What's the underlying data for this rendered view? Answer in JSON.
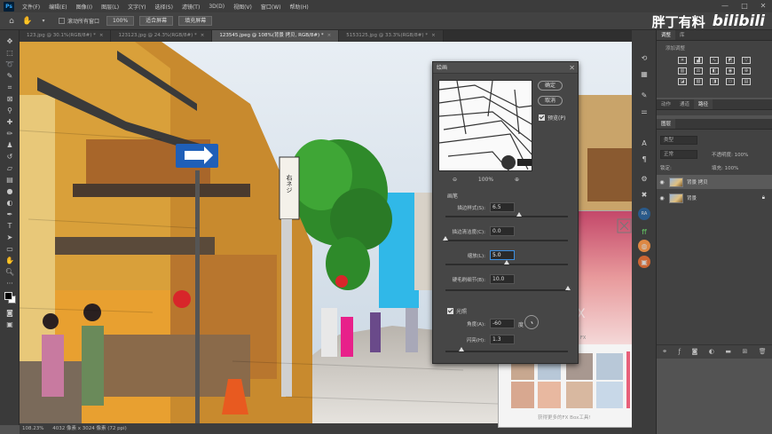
{
  "menubar": {
    "items": [
      "文件(F)",
      "编辑(E)",
      "图像(I)",
      "图层(L)",
      "文字(Y)",
      "选择(S)",
      "滤镜(T)",
      "3D(D)",
      "视图(V)",
      "窗口(W)",
      "帮助(H)"
    ],
    "window_controls": [
      "—",
      "□",
      "✕"
    ]
  },
  "options_bar": {
    "scroll_all_label": "滚动所有窗口",
    "zoom_value": "100%",
    "fit_screen": "适合屏幕",
    "fill_screen": "填充屏幕"
  },
  "brand": {
    "text": "胖丁有料",
    "logo": "bilibili"
  },
  "tabs": [
    {
      "label": "123.jpg @ 30.1%(RGB/8#) *",
      "active": false
    },
    {
      "label": "123123.jpg @ 24.3%(RGB/8#) *",
      "active": false
    },
    {
      "label": "123545.jpeg @ 108%(背景 拷贝, RGB/8#) *",
      "active": true
    },
    {
      "label": "5153125.jpg @ 33.3%(RGB/8#) *",
      "active": false
    }
  ],
  "status_bar": {
    "zoom": "108.23%",
    "doc_info": "4032 像素 x 3024 像素 (72 ppi)"
  },
  "dialog": {
    "title": "绘画",
    "ok": "确定",
    "cancel": "取消",
    "preview_label": "预览(P)",
    "zoom_percent": "100%",
    "section_brush": "画笔",
    "params": [
      {
        "label": "描边样式(S):",
        "value": "6.5",
        "slider_fraction": 0.6
      },
      {
        "label": "描边清洁度(C):",
        "value": "0.0",
        "slider_fraction": 0.0
      },
      {
        "label": "缩放(L):",
        "value": "5.0",
        "slider_fraction": 0.5
      },
      {
        "label": "硬毛刷细节(B):",
        "value": "10.0",
        "slider_fraction": 1.0
      }
    ],
    "lighting_label": "光照",
    "angle_label": "角度(A):",
    "angle_value": "-60",
    "angle_unit": "度",
    "shine_label": "闪亮(H):",
    "shine_value": "1.3",
    "shine_slider_fraction": 0.13
  },
  "right_panel": {
    "tabs_top": [
      "调整",
      "库"
    ],
    "add_adjustment": "添加调整",
    "tabs_mid": [
      "动作",
      "通道",
      "路径"
    ],
    "layers_tab": "图层",
    "kind_label": "类型",
    "blend_mode": "正常",
    "opacity_label": "不透明度: 100%",
    "lock_label": "锁定:",
    "fill_label": "填充: 100%",
    "layers": [
      {
        "name": "背景 拷贝",
        "selected": true,
        "locked": false
      },
      {
        "name": "背景",
        "selected": false,
        "locked": true
      }
    ]
  },
  "fx_panel": {
    "footer": "获得更多的FX Box工具!",
    "bg_letter": "X",
    "fx_text": "FX"
  },
  "street_sign": "右ネジ"
}
